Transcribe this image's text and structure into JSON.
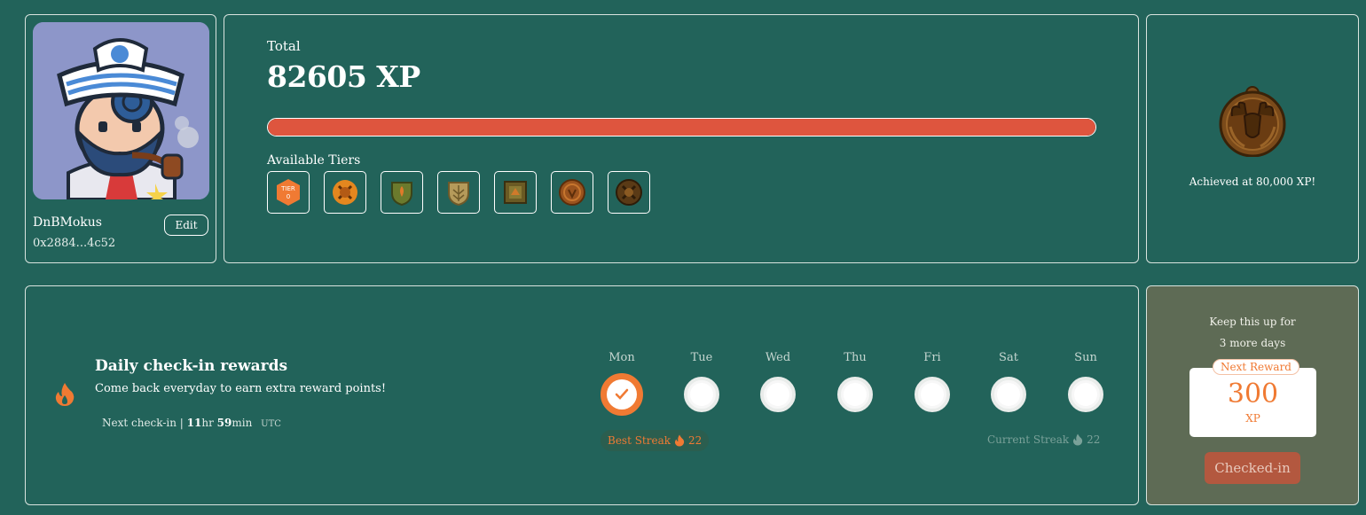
{
  "profile": {
    "username": "DnBMokus",
    "address": "0x2884...4c52",
    "edit_label": "Edit"
  },
  "xp": {
    "total_label": "Total",
    "total_value": "82605 XP",
    "progress": 1.0,
    "tiers_label": "Available Tiers",
    "tiers": [
      {
        "icon": "tier-0-badge-icon",
        "text": "TIER 0"
      },
      {
        "icon": "orange-crest-badge-icon"
      },
      {
        "icon": "green-shield-badge-icon"
      },
      {
        "icon": "leaf-shield-badge-icon"
      },
      {
        "icon": "square-crest-badge-icon"
      },
      {
        "icon": "bronze-medal-badge-icon"
      },
      {
        "icon": "dark-crest-badge-icon"
      }
    ]
  },
  "achieved": {
    "badge_icon": "moose-medal-icon",
    "text": "Achieved at 80,000 XP!"
  },
  "checkin": {
    "title": "Daily check-in rewards",
    "subtitle": "Come back everyday to earn extra reward points!",
    "next_label": "Next check-in |",
    "next_hours": "11",
    "next_hours_unit": "hr",
    "next_minutes": "59",
    "next_minutes_unit": "min",
    "timezone": "UTC",
    "days": [
      {
        "label": "Mon",
        "checked": true
      },
      {
        "label": "Tue",
        "checked": false
      },
      {
        "label": "Wed",
        "checked": false
      },
      {
        "label": "Thu",
        "checked": false
      },
      {
        "label": "Fri",
        "checked": false
      },
      {
        "label": "Sat",
        "checked": false
      },
      {
        "label": "Sun",
        "checked": false
      }
    ],
    "best_streak_label": "Best Streak",
    "best_streak_value": "22",
    "current_streak_label": "Current Streak",
    "current_streak_value": "22"
  },
  "reward": {
    "keep_line1": "Keep this up for",
    "keep_line2": "3 more days",
    "tag": "Next Reward",
    "value": "300",
    "unit": "XP",
    "button_label": "Checked-in"
  },
  "colors": {
    "background": "#22635a",
    "accent_orange": "#f07a33",
    "progress_red": "#de553e",
    "reward_panel": "#5e6b55"
  }
}
